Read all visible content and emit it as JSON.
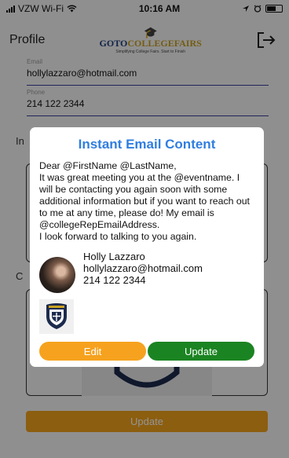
{
  "status_bar": {
    "carrier": "VZW Wi-Fi",
    "time": "10:16 AM"
  },
  "header": {
    "title": "Profile",
    "logo_brand_go": "GOTO",
    "logo_brand_rest": "COLLEGEFAIRS",
    "logo_tagline": "Simplifying College Fairs. Start to Finish"
  },
  "form": {
    "email_label": "Email",
    "email_value": "hollylazzaro@hotmail.com",
    "phone_label": "Phone",
    "phone_value": "214 122 2344",
    "stub1": "In",
    "stub2": "C",
    "update_label": "Update"
  },
  "modal": {
    "title": "Instant Email Content",
    "body_lines": [
      "Dear @FirstName @LastName,",
      "It was great meeting you at the @eventname. I will be contacting you again soon with some additional information but if you want to reach out to me at any time, please do! My email is @collegeRepEmailAddress.",
      "I look forward to talking to you again."
    ],
    "signature": {
      "name": "Holly Lazzaro",
      "email": "hollylazzaro@hotmail.com",
      "phone": "214 122 2344"
    },
    "edit_label": "Edit",
    "update_label": "Update"
  },
  "colors": {
    "accent_blue": "#2f7ee0",
    "edit_orange": "#f6a21e",
    "update_green": "#1b8422"
  },
  "icons": [
    "wifi-icon",
    "signal-icon",
    "location-arrow-icon",
    "alarm-icon",
    "battery-icon",
    "exit-icon",
    "graduation-cap-icon",
    "avatar",
    "university-shield-icon"
  ]
}
